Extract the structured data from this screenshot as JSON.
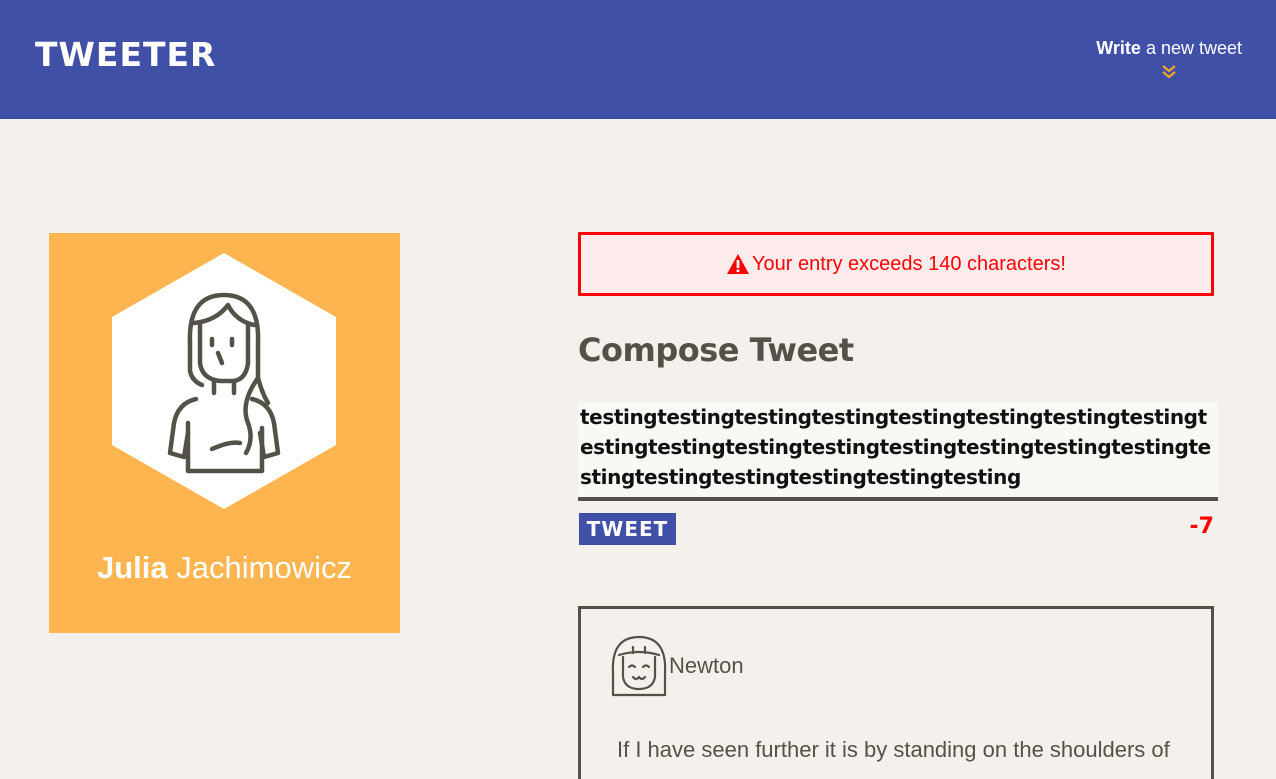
{
  "nav": {
    "logo": "TWEETER",
    "write_bold": "Write",
    "write_rest": " a new tweet",
    "chevron_icon": "double-chevron-down-icon",
    "chevron_color": "#f5a623"
  },
  "profile": {
    "first_name": "Julia",
    "last_name": "Jachimowicz",
    "background": "#ffb54f",
    "avatar_icon": "woman-avatar-icon"
  },
  "error": {
    "icon": "warning-icon",
    "message": "Your entry exceeds 140 characters!",
    "color": "#ff0000"
  },
  "compose": {
    "title": "Compose Tweet",
    "text": "testingtestingtestingtestingtestingtestingtestingtestingtestingtestingtestingtestingtestingtestingtestingtestingtestingtestingtestingtestingtestingtesting",
    "button_label": "TWEET",
    "counter": "-7"
  },
  "tweets": [
    {
      "author": "Newton",
      "avatar_icon": "smiling-avatar-icon",
      "content": "If I have seen further it is by standing on the shoulders of"
    }
  ],
  "colors": {
    "brand": "#4150a7",
    "page_bg": "#f4f1ec",
    "text": "#545149"
  }
}
